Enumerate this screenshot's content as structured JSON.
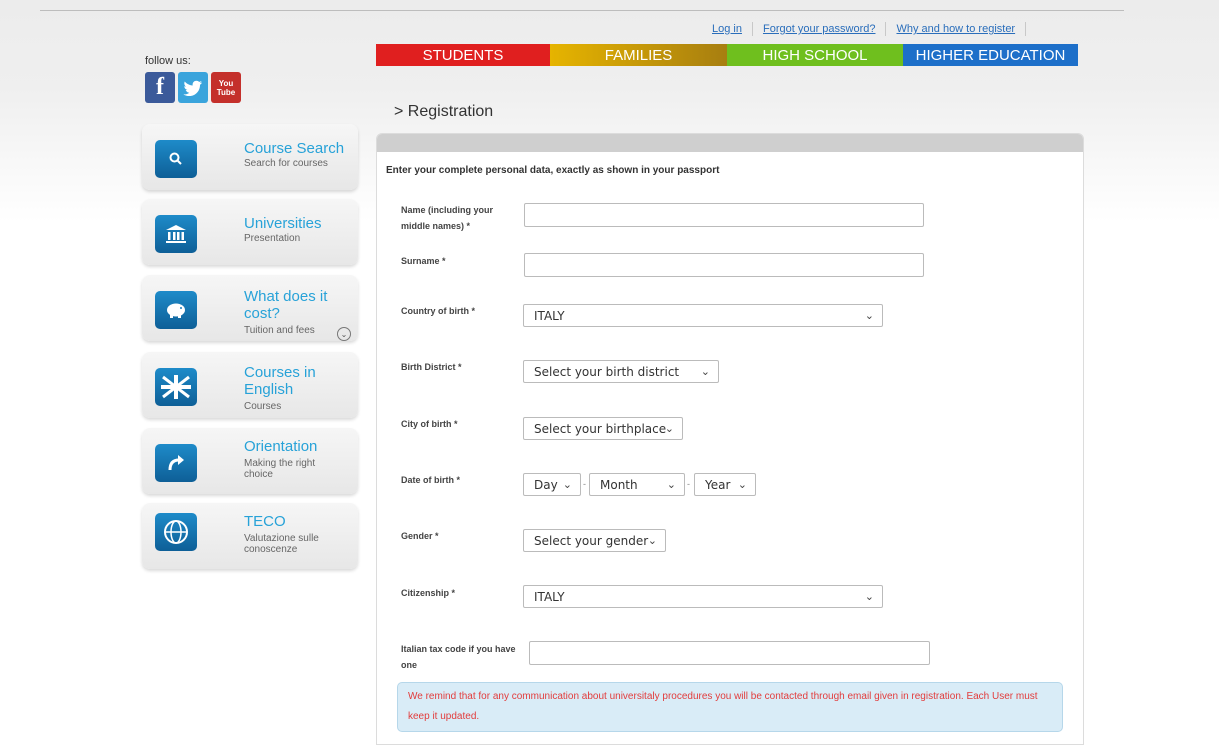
{
  "top_links": [
    "Log in",
    "Forgot your password?",
    "Why and how to register"
  ],
  "follow_label": "follow us:",
  "social": {
    "facebook": "f",
    "youtube_top": "You",
    "youtube_bottom": "Tube"
  },
  "tabs": [
    "STUDENTS",
    "FAMILIES",
    "HIGH SCHOOL",
    "HIGHER EDUCATION"
  ],
  "sidebar": [
    {
      "title": "Course Search",
      "subtitle": "Search for courses",
      "icon": "search-icon"
    },
    {
      "title": "Universities",
      "subtitle": "Presentation",
      "icon": "university-icon"
    },
    {
      "title": "What does it cost?",
      "subtitle": "Tuition and fees",
      "icon": "piggy-bank-icon"
    },
    {
      "title": "Courses in English",
      "subtitle": "Courses",
      "icon": "union-jack-icon"
    },
    {
      "title": "Orientation",
      "subtitle": "Making the right choice",
      "icon": "arrow-turn-icon"
    },
    {
      "title": "TECO",
      "subtitle": "Valutazione sulle conoscenze",
      "icon": "globe-icon"
    }
  ],
  "breadcrumb": "> Registration",
  "form": {
    "intro": "Enter your complete personal data, exactly as shown in your passport",
    "name_label": "Name (including your middle names) *",
    "name_value": "",
    "surname_label": "Surname *",
    "surname_value": "",
    "country_label": "Country of birth *",
    "country_value": "ITALY",
    "district_label": "Birth District *",
    "district_value": "Select your birth district",
    "city_label": "City of birth *",
    "city_value": "Select your birthplace",
    "dob_label": "Date of birth *",
    "dob_day": "Day",
    "dob_month": "Month",
    "dob_year": "Year",
    "gender_label": "Gender *",
    "gender_value": "Select your gender",
    "citizenship_label": "Citizenship *",
    "citizenship_value": "ITALY",
    "taxcode_label": "Italian tax code if you have one",
    "taxcode_value": "",
    "notice": "We remind that for any communication about universitaly procedures you will be contacted through email given in registration. Each User must keep it updated."
  },
  "colors": {
    "students": "#e01f1f",
    "families": "#e6b400",
    "high_school": "#6fbf1e",
    "higher_education": "#1d6fc9",
    "accent": "#27a2d8"
  }
}
